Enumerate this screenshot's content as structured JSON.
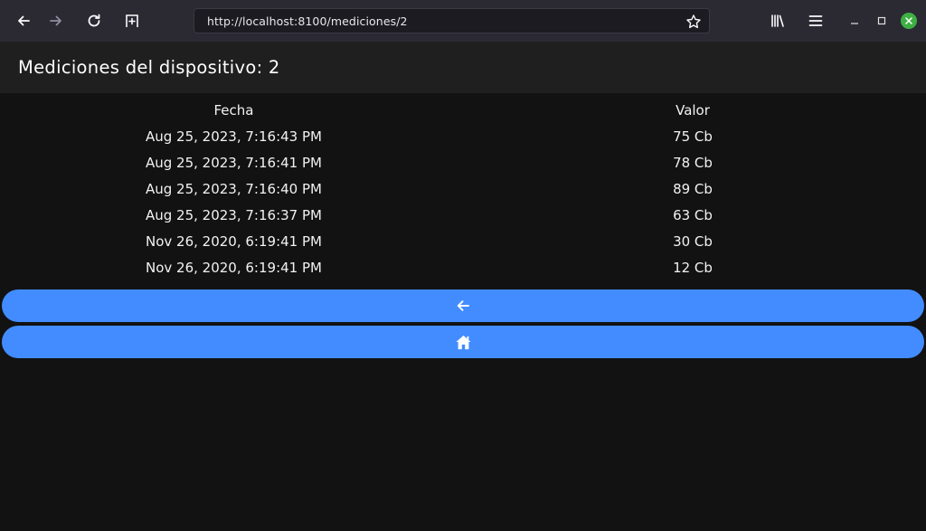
{
  "browser": {
    "url": "http://localhost:8100/mediciones/2"
  },
  "header": {
    "title": "Mediciones del dispositivo: 2"
  },
  "table": {
    "columns": [
      "Fecha",
      "Valor"
    ],
    "rows": [
      {
        "fecha": "Aug 25, 2023, 7:16:43 PM",
        "valor": "75 Cb"
      },
      {
        "fecha": "Aug 25, 2023, 7:16:41 PM",
        "valor": "78 Cb"
      },
      {
        "fecha": "Aug 25, 2023, 7:16:40 PM",
        "valor": "89 Cb"
      },
      {
        "fecha": "Aug 25, 2023, 7:16:37 PM",
        "valor": "63 Cb"
      },
      {
        "fecha": "Nov 26, 2020, 6:19:41 PM",
        "valor": "30 Cb"
      },
      {
        "fecha": "Nov 26, 2020, 6:19:41 PM",
        "valor": "12 Cb"
      }
    ]
  },
  "buttons": {
    "back_icon": "arrow-back-icon",
    "home_icon": "home-icon"
  },
  "colors": {
    "primary": "#428cff",
    "background": "#121212",
    "header_bg": "#1f1f1f",
    "browser_bg": "#2b2a33"
  }
}
